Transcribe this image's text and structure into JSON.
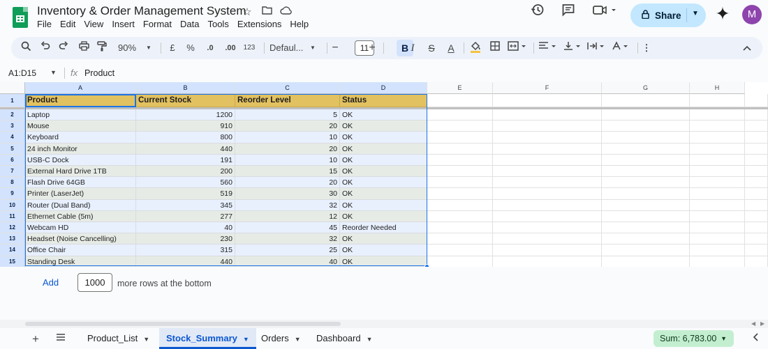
{
  "app": {
    "doc_title": "Inventory & Order Management System",
    "menu": [
      "File",
      "Edit",
      "View",
      "Insert",
      "Format",
      "Data",
      "Tools",
      "Extensions",
      "Help"
    ],
    "share_label": "Share",
    "avatar_initial": "M"
  },
  "toolbar": {
    "zoom": "90%",
    "currency": "£",
    "percent": "%",
    "dec_decrease": ".0",
    "dec_increase": ".00",
    "more_formats": "123",
    "font": "Defaul...",
    "font_size": "11",
    "bold": "B",
    "italic": "I",
    "strike": "S",
    "text_color": "A"
  },
  "formula_bar": {
    "name_box": "A1:D15",
    "fx": "fx",
    "value": "Product"
  },
  "sheet": {
    "columns": [
      "A",
      "B",
      "C",
      "D",
      "E",
      "F",
      "G",
      "H"
    ],
    "header": [
      "Product",
      "Current Stock",
      "Reorder Level",
      "Status"
    ],
    "rows": [
      {
        "n": "2",
        "product": "Laptop",
        "stock": "1200",
        "reorder": "5",
        "status": "OK"
      },
      {
        "n": "3",
        "product": "Mouse",
        "stock": "910",
        "reorder": "20",
        "status": "OK"
      },
      {
        "n": "4",
        "product": "Keyboard",
        "stock": "800",
        "reorder": "10",
        "status": "OK"
      },
      {
        "n": "5",
        "product": "24 inch Monitor",
        "stock": "440",
        "reorder": "20",
        "status": "OK"
      },
      {
        "n": "6",
        "product": "USB-C Dock",
        "stock": "191",
        "reorder": "10",
        "status": "OK"
      },
      {
        "n": "7",
        "product": "External Hard Drive 1TB",
        "stock": "200",
        "reorder": "15",
        "status": "OK"
      },
      {
        "n": "8",
        "product": "Flash Drive 64GB",
        "stock": "560",
        "reorder": "20",
        "status": "OK"
      },
      {
        "n": "9",
        "product": "Printer (LaserJet)",
        "stock": "519",
        "reorder": "30",
        "status": "OK"
      },
      {
        "n": "10",
        "product": "Router (Dual Band)",
        "stock": "345",
        "reorder": "32",
        "status": "OK"
      },
      {
        "n": "11",
        "product": "Ethernet Cable (5m)",
        "stock": "277",
        "reorder": "12",
        "status": "OK"
      },
      {
        "n": "12",
        "product": "Webcam HD",
        "stock": "40",
        "reorder": "45",
        "status": "Reorder Needed"
      },
      {
        "n": "13",
        "product": "Headset (Noise Cancelling)",
        "stock": "230",
        "reorder": "32",
        "status": "OK"
      },
      {
        "n": "14",
        "product": "Office Chair",
        "stock": "315",
        "reorder": "25",
        "status": "OK"
      },
      {
        "n": "15",
        "product": "Standing Desk",
        "stock": "440",
        "reorder": "40",
        "status": "OK"
      }
    ]
  },
  "add_rows": {
    "button": "Add",
    "count": "1000",
    "label": "more rows at the bottom"
  },
  "tabs": [
    {
      "label": "Product_List",
      "active": false
    },
    {
      "label": "Stock_Summary",
      "active": true
    },
    {
      "label": "Orders",
      "active": false
    },
    {
      "label": "Dashboard",
      "active": false
    }
  ],
  "status": {
    "sum": "Sum: 6,783.00"
  },
  "colors": {
    "header_fill": "#e2c160",
    "selection": "#1a73e8",
    "band_a": "#e8f0fe",
    "band_b": "#e6ebe6",
    "share_bg": "#c2e7ff",
    "sum_bg": "#c4eed0",
    "accent": "#0b57d0"
  }
}
